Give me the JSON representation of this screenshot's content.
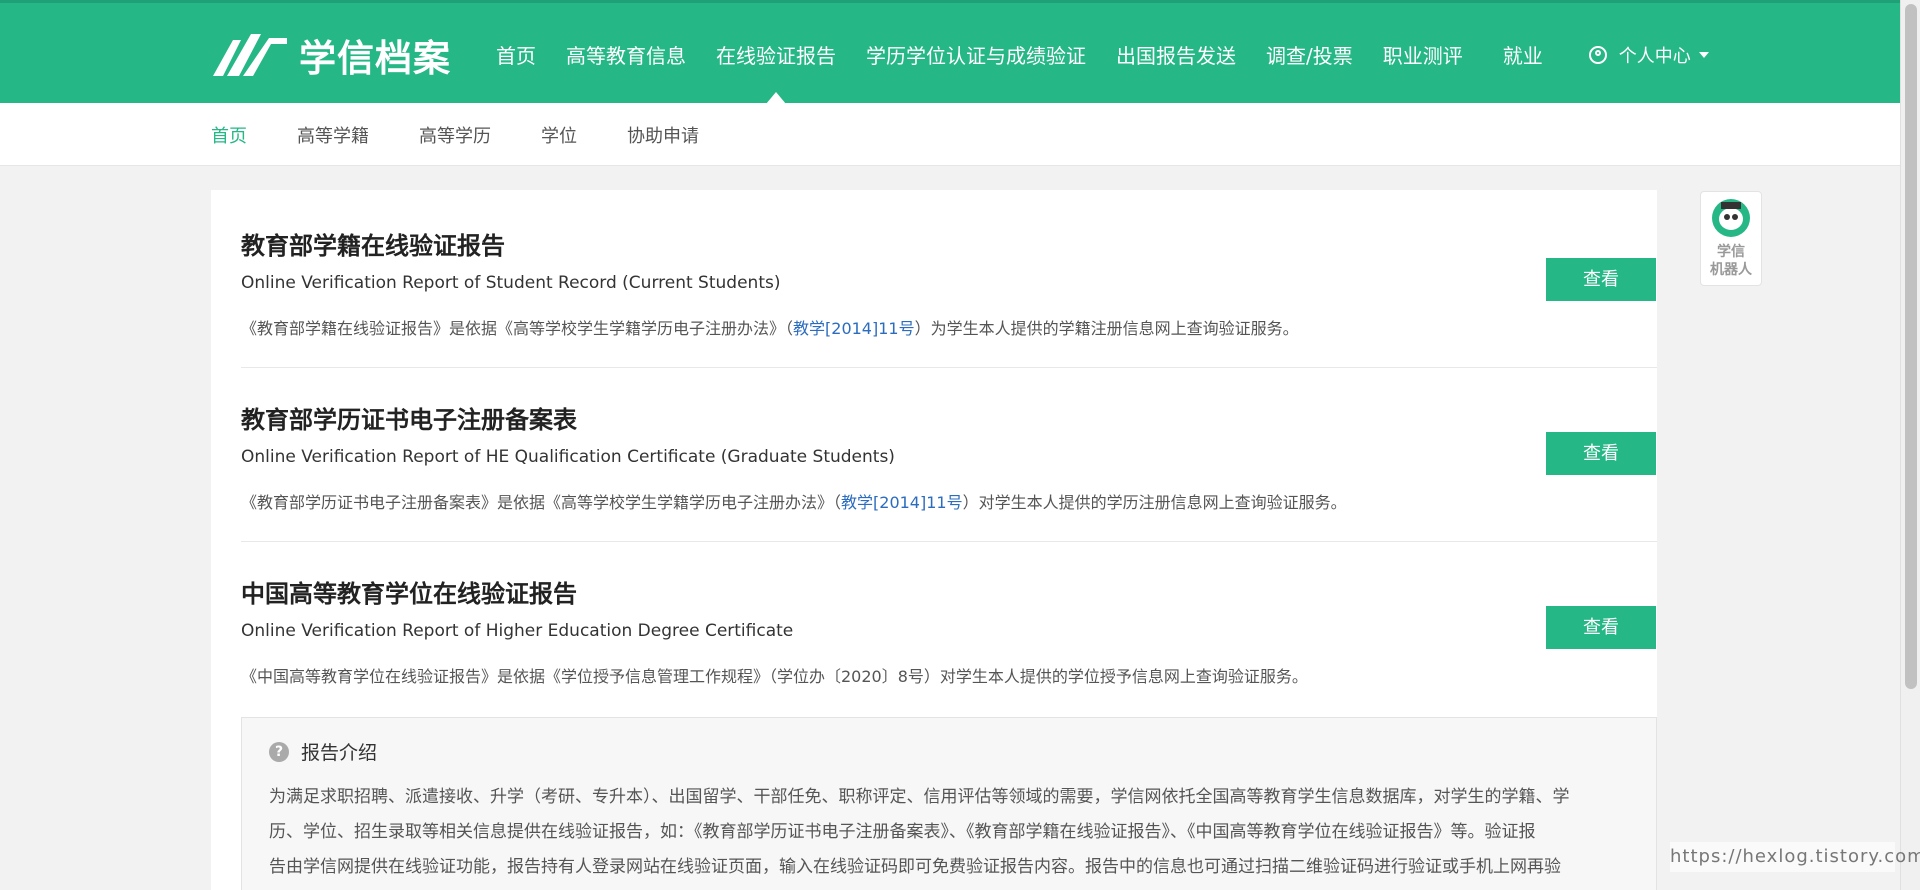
{
  "brand": {
    "name": "学信档案"
  },
  "nav": {
    "items": [
      "首页",
      "高等教育信息",
      "在线验证报告",
      "学历学位认证与成绩验证",
      "出国报告发送",
      "调查/投票",
      "职业测评",
      "就业"
    ],
    "user_menu": "个人中心"
  },
  "subnav": {
    "items": [
      "首页",
      "高等学籍",
      "高等学历",
      "学位",
      "协助申请"
    ]
  },
  "reports": [
    {
      "title": "教育部学籍在线验证报告",
      "en": "Online Verification Report of Student Record (Current Students)",
      "desc_pre": "《教育部学籍在线验证报告》是依据《高等学校学生学籍学历电子注册办法》（",
      "desc_link": "教学[2014]11号",
      "desc_post": "）为学生本人提供的学籍注册信息网上查询验证服务。",
      "button": "查看"
    },
    {
      "title": "教育部学历证书电子注册备案表",
      "en": "Online Verification Report of HE Qualification Certificate (Graduate Students)",
      "desc_pre": "《教育部学历证书电子注册备案表》是依据《高等学校学生学籍学历电子注册办法》（",
      "desc_link": "教学[2014]11号",
      "desc_post": "）对学生本人提供的学历注册信息网上查询验证服务。",
      "button": "查看"
    },
    {
      "title": "中国高等教育学位在线验证报告",
      "en": "Online Verification Report of Higher Education Degree Certificate",
      "desc_pre": "《中国高等教育学位在线验证报告》是依据《学位授予信息管理工作规程》（学位办〔2020〕8号）对学生本人提供的学位授予信息网上查询验证服务。",
      "desc_link": "",
      "desc_post": "",
      "button": "查看"
    }
  ],
  "intro": {
    "title": "报告介绍",
    "icon": "question-circle-icon",
    "lines": [
      "为满足求职招聘、派遣接收、升学（考研、专升本）、出国留学、干部任免、职称评定、信用评估等领域的需要，学信网依托全国高等教育学生信息数据库，对学生的学籍、学",
      "历、学位、招生录取等相关信息提供在线验证报告，如：《教育部学历证书电子注册备案表》、《教育部学籍在线验证报告》、《中国高等教育学位在线验证报告》等。验证报",
      "告由学信网提供在线验证功能，报告持有人登录网站在线验证页面，输入在线验证码即可免费验证报告内容。报告中的信息也可通过扫描二维验证码进行验证或手机上网再验"
    ]
  },
  "robot": {
    "label_line1": "学信",
    "label_line2": "机器人"
  },
  "watermark": "https://hexlog.tistory.com",
  "colors": {
    "brand_green": "#26b787",
    "link_blue": "#2b6cbf"
  }
}
